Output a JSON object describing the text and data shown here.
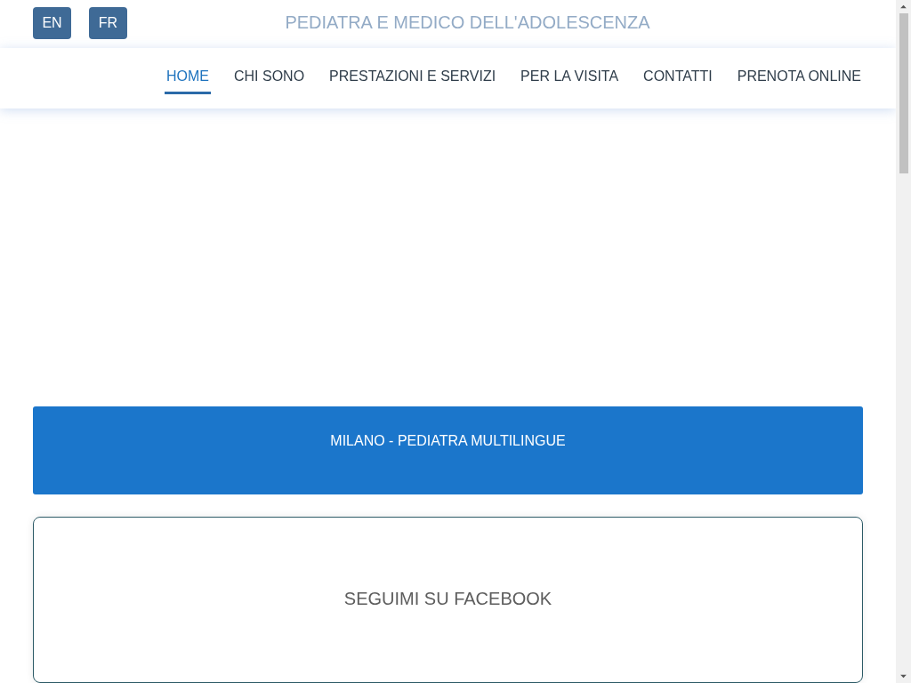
{
  "languages": [
    {
      "label": "EN"
    },
    {
      "label": "FR"
    }
  ],
  "tagline": "PEDIATRA E MEDICO DELL'ADOLESCENZA",
  "nav": [
    {
      "label": "HOME",
      "selected": true
    },
    {
      "label": "CHI SONO",
      "selected": false
    },
    {
      "label": "PRESTAZIONI E SERVIZI",
      "selected": false
    },
    {
      "label": "PER LA VISITA",
      "selected": false
    },
    {
      "label": "CONTATTI",
      "selected": false
    },
    {
      "label": "PRENOTA ONLINE",
      "selected": false
    }
  ],
  "banner": {
    "title": "MILANO - PEDIATRA MULTILINGUE"
  },
  "facebook_card": {
    "title": "SEGUIMI SU FACEBOOK"
  }
}
